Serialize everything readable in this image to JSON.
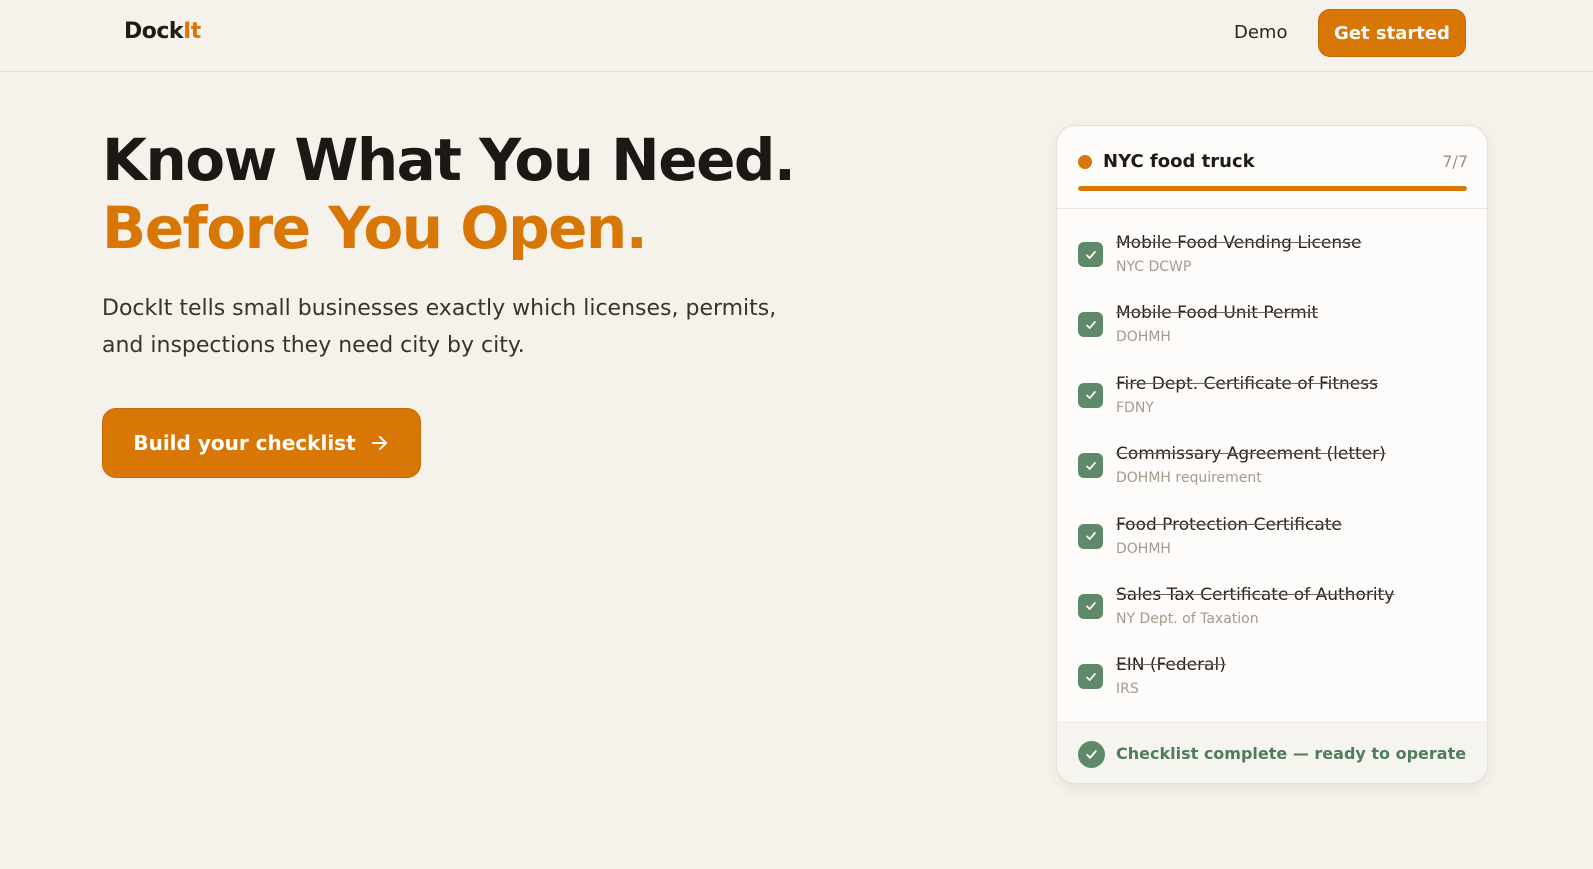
{
  "header": {
    "logo_main": "Dock",
    "logo_accent": "It",
    "nav_demo": "Demo",
    "cta_label": "Get started"
  },
  "hero": {
    "title_line1": "Know What You Need.",
    "title_line2": "Before You Open.",
    "subtitle": "DockIt tells small businesses exactly which licenses, permits, and inspections they need city by city.",
    "cta_label": "Build your checklist",
    "cta_icon": "arrow-right-icon"
  },
  "card": {
    "title": "NYC food truck",
    "count": "7/7",
    "progress": 1.0,
    "items": [
      {
        "label": "Mobile Food Vending License",
        "agency": "NYC DCWP",
        "checked": true
      },
      {
        "label": "Mobile Food Unit Permit",
        "agency": "DOHMH",
        "checked": true
      },
      {
        "label": "Fire Dept. Certificate of Fitness",
        "agency": "FDNY",
        "checked": true
      },
      {
        "label": "Commissary Agreement (letter)",
        "agency": "DOHMH requirement",
        "checked": true
      },
      {
        "label": "Food Protection Certificate",
        "agency": "DOHMH",
        "checked": true
      },
      {
        "label": "Sales Tax Certificate of Authority",
        "agency": "NY Dept. of Taxation",
        "checked": true
      },
      {
        "label": "EIN (Federal)",
        "agency": "IRS",
        "checked": true
      }
    ],
    "footer_text": "Checklist complete — ready to operate"
  },
  "colors": {
    "accent": "#d97706",
    "success": "#5e8a6a",
    "background": "#f5f2ec"
  }
}
